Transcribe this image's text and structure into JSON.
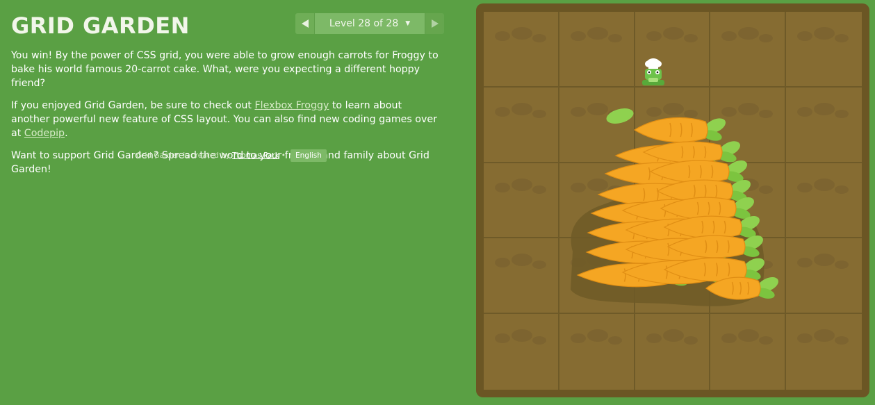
{
  "app": {
    "title": "GRID GARDEN"
  },
  "level_nav": {
    "label": "Level 28 of 28",
    "prev_icon": "left-triangle-icon",
    "next_icon": "right-triangle-icon",
    "caret_icon": "caret-down-icon"
  },
  "content": {
    "p1": "You win! By the power of CSS grid, you were able to grow enough carrots for Froggy to bake his world famous 20-carrot cake. What, were you expecting a different hoppy friend?",
    "p2_before": "If you enjoyed Grid Garden, be sure to check out ",
    "p2_link1": "Flexbox Froggy",
    "p2_middle": " to learn about another powerful new feature of CSS layout. You can also find new coding games over at ",
    "p2_link2": "Codepip",
    "p2_after": ".",
    "p3": "Want to support Grid Garden? Spread the word to your friends and family about Grid Garden!"
  },
  "credits": {
    "prefix": "Grid Garden is created by",
    "author": "Thomas Park",
    "separator": "•",
    "language": "English"
  },
  "board": {
    "rows": 5,
    "columns": 5,
    "carrot_count": 20
  },
  "colors": {
    "background": "#5aa044",
    "board_frame": "#6b5624",
    "soil": "#866c32",
    "carrot": "#f5a623",
    "leaf": "#8fd14f",
    "link": "#d8ecc9"
  }
}
